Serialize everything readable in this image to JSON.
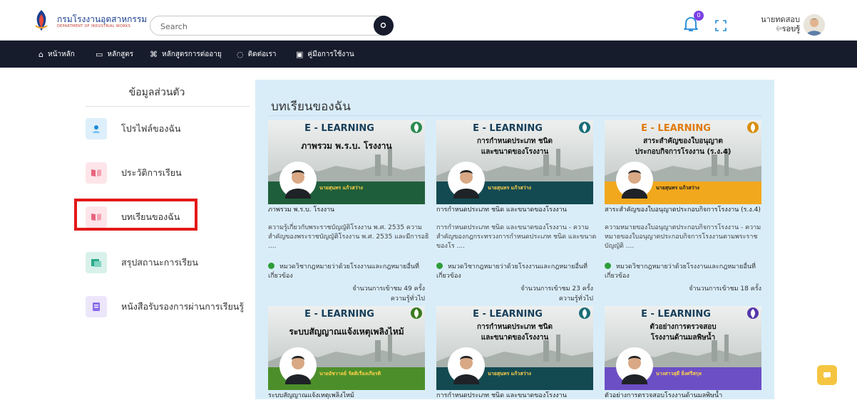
{
  "header": {
    "logo_text_th": "กรมโรงงานอุตสาหกรรม",
    "logo_text_en": "DEPARTMENT OF INDUSTRIAL WORKS",
    "search_placeholder": "Search",
    "notification_count": "0",
    "user_name": "นายทดสอบ รอบรู้",
    "user_role": "ผู้ตรวจสอบ"
  },
  "nav": {
    "items": [
      {
        "label": "หน้าหลัก",
        "icon": "home-icon"
      },
      {
        "label": "หลักสูตร",
        "icon": "book-icon"
      },
      {
        "label": "หลักสูตรการต่ออายุ",
        "icon": "command-icon"
      },
      {
        "label": "ติดต่อเรา",
        "icon": "chat-icon"
      },
      {
        "label": "คู่มือการใช้งาน",
        "icon": "manual-icon"
      }
    ]
  },
  "sidebar": {
    "title": "ข้อมูลส่วนตัว",
    "items": [
      {
        "label": "โปรไฟล์ของฉัน",
        "icon": "user-icon"
      },
      {
        "label": "ประวัติการเรียน",
        "icon": "history-book-icon"
      },
      {
        "label": "บทเรียนของฉัน",
        "icon": "lessons-book-icon"
      },
      {
        "label": "สรุปสถานะการเรียน",
        "icon": "summary-icon"
      },
      {
        "label": "หนังสือรับรองการผ่านการเรียนรู้",
        "icon": "certificate-icon"
      }
    ]
  },
  "main": {
    "title": "บทเรียนของฉัน",
    "cards": [
      {
        "banner_title": "E - LEARNING",
        "banner_subtitle": "ภาพรวม พ.ร.บ. โรงงาน",
        "banner_subtitle2": "",
        "instructor": "นายสุนทร แก้วสว่าง",
        "title": "ภาพรวม พ.ร.บ. โรงงาน",
        "desc": "ความรู้เกี่ยวกับพระราชบัญญัติโรงงาน พ.ศ. 2535 ความสำคัญของพระราชบัญญัติโรงงาน พ.ศ. 2535 และมีการอธิ ....",
        "category": "หมวดวิชากฎหมายว่าด้วยโรงงานและกฎหมายอื่นที่เกี่ยวข้อง",
        "visits": "จำนวนการเข้าชม 49 ครั้ง",
        "level": "ความรู้ทั่วไป",
        "theme": "green"
      },
      {
        "banner_title": "E - LEARNING",
        "banner_subtitle": "การกำหนดประเภท ชนิด",
        "banner_subtitle2": "และขนาดของโรงงาน",
        "instructor": "นายสุนทร แก้วสว่าง",
        "title": "การกำหนดประเภท ชนิด และขนาดของโรงงาน",
        "desc": "การกำหนดประเภท ชนิด และขนาดของโรงงาน - ความสำคัญของกฎกระทรวงการกำหนดประเภท ชนิด และขนาดของโร ....",
        "category": "หมวดวิชากฎหมายว่าด้วยโรงงานและกฎหมายอื่นที่เกี่ยวข้อง",
        "visits": "จำนวนการเข้าชม 23 ครั้ง",
        "level": "ความรู้ทั่วไป",
        "theme": "teal"
      },
      {
        "banner_title": "E - LEARNING",
        "banner_subtitle": "สาระสำคัญของใบอนุญาต",
        "banner_subtitle2": "ประกอบกิจการโรงงาน (ร.ง.4)",
        "instructor": "นายสุนทร แก้วสว่าง",
        "title": "สาระสำคัญของใบอนุญาตประกอบกิจการโรงงาน (ร.ง.4)",
        "desc": "ความหมายของใบอนุญาตประกอบกิจการโรงงาน - ความหมายของใบอนุญาตประกอบกิจการโรงงานตามพระราชบัญญัติ ....",
        "category": "หมวดวิชากฎหมายว่าด้วยโรงงานและกฎหมายอื่นที่เกี่ยวข้อง",
        "visits": "จำนวนการเข้าชม 18 ครั้ง",
        "level": "",
        "theme": "orange"
      },
      {
        "banner_title": "E - LEARNING",
        "banner_subtitle": "ระบบสัญญาณแจ้งเหตุเพลิงไหม้",
        "banner_subtitle2": "",
        "instructor": "นายอัชวาลย์ รัตติเรืองเกียรติ",
        "title": "ระบบสัญญาณแจ้งเหตุเพลิงไหม้",
        "theme": "lime"
      },
      {
        "banner_title": "E - LEARNING",
        "banner_subtitle": "การกำหนดประเภท ชนิด",
        "banner_subtitle2": "และขนาดของโรงงาน",
        "instructor": "นายสุนทร แก้วสว่าง",
        "title": "การกำหนดประเภท ชนิด และขนาดของโรงงาน",
        "theme": "teal"
      },
      {
        "banner_title": "E - LEARNING",
        "banner_subtitle": "ตัวอย่างการตรวจสอบ",
        "banner_subtitle2": "โรงงานด้านมลพิษน้ำ",
        "instructor": "นางสาวสุดี ยิ่งศรีสกุล",
        "title": "ตัวอย่างการตรวจสอบโรงงานด้านมลพิษน้ำ",
        "theme": "purple"
      }
    ]
  },
  "colors": {
    "nav_bg": "#161c2c",
    "main_bg": "#d9edf9",
    "highlight": "#e41818",
    "badge": "#7b3fe4",
    "fab": "#f5c542"
  }
}
